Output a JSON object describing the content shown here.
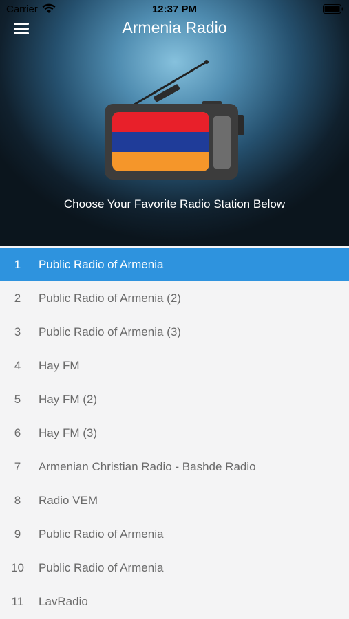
{
  "status_bar": {
    "carrier": "Carrier",
    "time": "12:37 PM"
  },
  "header": {
    "title": "Armenia Radio",
    "subtitle": "Choose Your Favorite Radio Station Below",
    "menu_icon": "hamburger-menu-icon",
    "flag_colors": [
      "#e8202a",
      "#1f3c99",
      "#f5962a"
    ]
  },
  "colors": {
    "selected_row": "#2e93de",
    "list_background": "#f4f4f5"
  },
  "stations": [
    {
      "num": "1",
      "name": "Public Radio of Armenia",
      "selected": true
    },
    {
      "num": "2",
      "name": "Public Radio of Armenia (2)"
    },
    {
      "num": "3",
      "name": "Public Radio of Armenia (3)"
    },
    {
      "num": "4",
      "name": "Hay FM"
    },
    {
      "num": "5",
      "name": "Hay FM (2)"
    },
    {
      "num": "6",
      "name": "Hay FM (3)"
    },
    {
      "num": "7",
      "name": "Armenian Christian Radio - Bashde Radio"
    },
    {
      "num": "8",
      "name": "Radio VEM"
    },
    {
      "num": "9",
      "name": "Public Radio of Armenia"
    },
    {
      "num": "10",
      "name": "Public Radio of Armenia"
    },
    {
      "num": "11",
      "name": "LavRadio"
    }
  ]
}
